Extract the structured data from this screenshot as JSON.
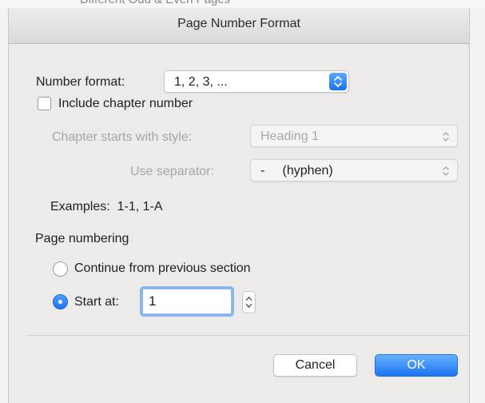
{
  "background": {
    "partial_text": "Different Odd & Even Pages"
  },
  "dialog": {
    "title": "Page Number Format",
    "number_format": {
      "label": "Number format:",
      "value": "1, 2, 3, ..."
    },
    "include_chapter": {
      "label": "Include chapter number",
      "checked": false
    },
    "chapter_style": {
      "label": "Chapter starts with style:",
      "value": "Heading 1",
      "enabled": false
    },
    "separator": {
      "label": "Use separator:",
      "value": "-     (hyphen)",
      "enabled": false
    },
    "examples": "Examples:  1-1, 1-A",
    "page_numbering": {
      "heading": "Page numbering",
      "continue_label": "Continue from previous section",
      "start_at_label": "Start at:",
      "selected": "start_at",
      "start_at_value": "1"
    },
    "buttons": {
      "cancel": "Cancel",
      "ok": "OK"
    }
  },
  "colors": {
    "accent": "#1b74f1",
    "disabled_text": "#a6a6a6",
    "window_bg": "#ecebe9"
  },
  "icons": {
    "popup_arrows": "updown-chevron-icon",
    "stepper": "stepper-icon"
  }
}
